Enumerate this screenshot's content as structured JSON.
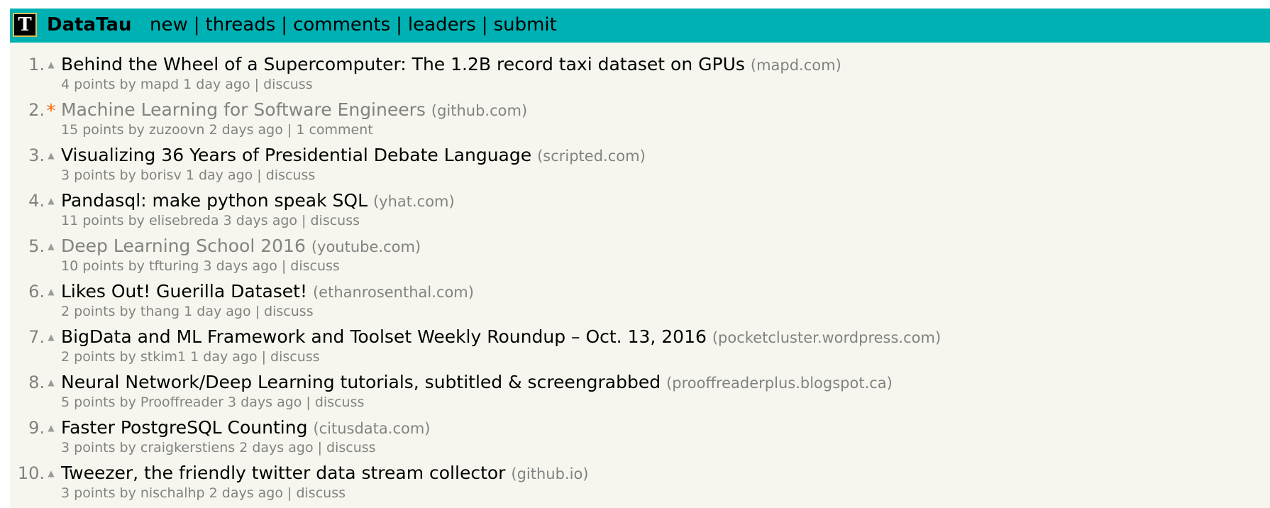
{
  "header": {
    "logo_letter": "T",
    "site_name": "DataTau",
    "nav": [
      "new",
      "threads",
      "comments",
      "leaders",
      "submit"
    ],
    "bg_color": "#00b1b3"
  },
  "items": [
    {
      "rank": "1.",
      "vote": "▲",
      "title": "Behind the Wheel of a Supercomputer: The 1.2B record taxi dataset on GPUs",
      "domain": "(mapd.com)",
      "subtext": "4 points by mapd 1 day ago | discuss"
    },
    {
      "rank": "2.",
      "vote": "*",
      "title": "Machine Learning for Software Engineers",
      "domain": "(github.com)",
      "subtext": "15 points by zuzoovn 2 days ago | 1 comment"
    },
    {
      "rank": "3.",
      "vote": "▲",
      "title": "Visualizing 36 Years of Presidential Debate Language",
      "domain": "(scripted.com)",
      "subtext": "3 points by borisv 1 day ago | discuss"
    },
    {
      "rank": "4.",
      "vote": "▲",
      "title": "Pandasql: make python speak SQL",
      "domain": "(yhat.com)",
      "subtext": "11 points by elisebreda 3 days ago | discuss"
    },
    {
      "rank": "5.",
      "vote": "▲",
      "title": "Deep Learning School 2016",
      "domain": "(youtube.com)",
      "subtext": "10 points by tfturing 3 days ago | discuss"
    },
    {
      "rank": "6.",
      "vote": "▲",
      "title": "Likes Out! Guerilla Dataset!",
      "domain": "(ethanrosenthal.com)",
      "subtext": "2 points by thang 1 day ago | discuss"
    },
    {
      "rank": "7.",
      "vote": "▲",
      "title": "BigData and ML Framework and Toolset Weekly Roundup – Oct. 13, 2016",
      "domain": "(pocketcluster.wordpress.com)",
      "subtext": "2 points by stkim1 1 day ago | discuss"
    },
    {
      "rank": "8.",
      "vote": "▲",
      "title": "Neural Network/Deep Learning tutorials, subtitled & screengrabbed",
      "domain": "(prooffreaderplus.blogspot.ca)",
      "subtext": "5 points by Prooffreader 3 days ago | discuss"
    },
    {
      "rank": "9.",
      "vote": "▲",
      "title": "Faster PostgreSQL Counting",
      "domain": "(citusdata.com)",
      "subtext": "3 points by craigkerstiens 2 days ago | discuss"
    },
    {
      "rank": "10.",
      "vote": "▲",
      "title": "Tweezer, the friendly twitter data stream collector",
      "domain": "(github.io)",
      "subtext": "3 points by nischalhp 2 days ago | discuss"
    }
  ]
}
